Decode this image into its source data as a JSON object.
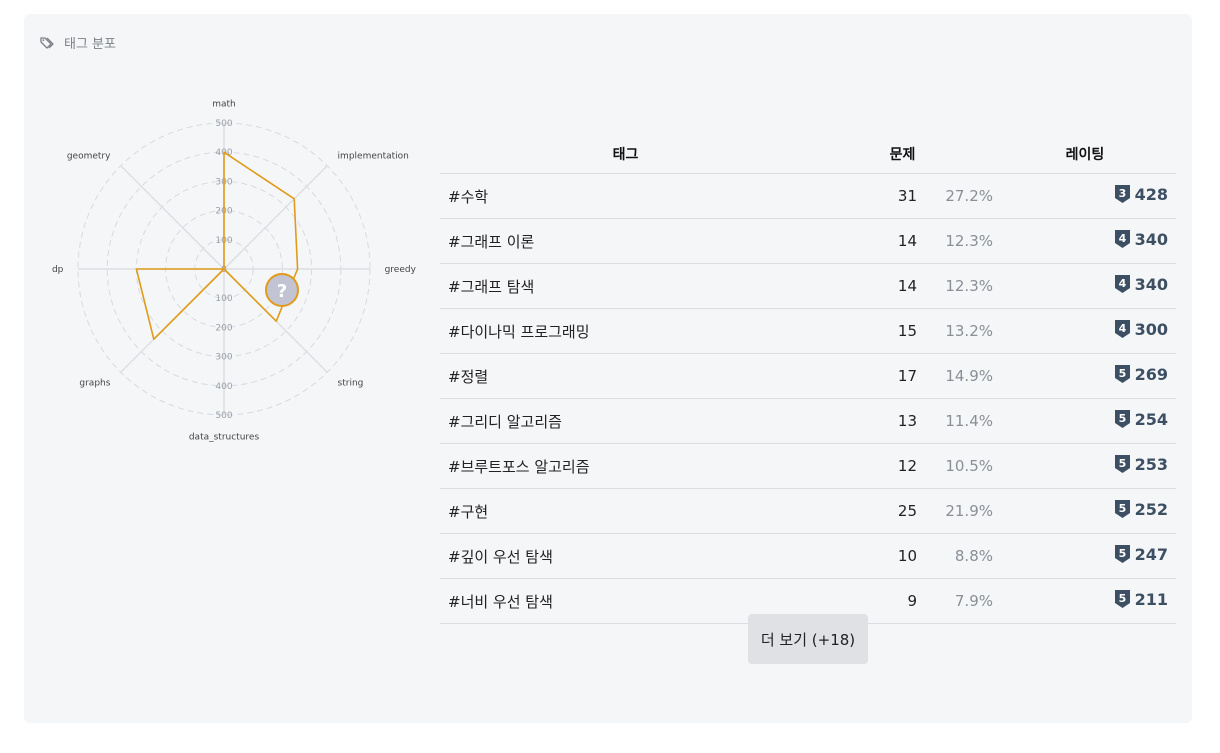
{
  "header": {
    "title": "태그 분포",
    "icon": "tags-icon"
  },
  "chart_data": {
    "type": "radar",
    "axes": [
      "math",
      "implementation",
      "greedy",
      "string",
      "data_structures",
      "graphs",
      "dp",
      "geometry"
    ],
    "values": [
      400,
      340,
      252,
      253,
      0,
      340,
      300,
      0
    ],
    "rmax": 500,
    "ticks": [
      0,
      100,
      200,
      300,
      400,
      500
    ],
    "series_color": "#e09b1a",
    "marker": {
      "label": "?",
      "fill": "#c2c4d4",
      "stroke": "#e09b1a"
    }
  },
  "table": {
    "headers": {
      "tag": "태그",
      "count": "문제",
      "rating": "레이팅"
    },
    "rows": [
      {
        "tag": "#수학",
        "count": "31",
        "ratio": "27.2%",
        "tier": "3",
        "rating": "428"
      },
      {
        "tag": "#그래프 이론",
        "count": "14",
        "ratio": "12.3%",
        "tier": "4",
        "rating": "340"
      },
      {
        "tag": "#그래프 탐색",
        "count": "14",
        "ratio": "12.3%",
        "tier": "4",
        "rating": "340"
      },
      {
        "tag": "#다이나믹 프로그래밍",
        "count": "15",
        "ratio": "13.2%",
        "tier": "4",
        "rating": "300"
      },
      {
        "tag": "#정렬",
        "count": "17",
        "ratio": "14.9%",
        "tier": "5",
        "rating": "269"
      },
      {
        "tag": "#그리디 알고리즘",
        "count": "13",
        "ratio": "11.4%",
        "tier": "5",
        "rating": "254"
      },
      {
        "tag": "#브루트포스 알고리즘",
        "count": "12",
        "ratio": "10.5%",
        "tier": "5",
        "rating": "253"
      },
      {
        "tag": "#구현",
        "count": "25",
        "ratio": "21.9%",
        "tier": "5",
        "rating": "252"
      },
      {
        "tag": "#깊이 우선 탐색",
        "count": "10",
        "ratio": "8.8%",
        "tier": "5",
        "rating": "247"
      },
      {
        "tag": "#너비 우선 탐색",
        "count": "9",
        "ratio": "7.9%",
        "tier": "5",
        "rating": "211"
      }
    ]
  },
  "more_button": {
    "label": "더 보기 (+18)"
  },
  "colors": {
    "badge": "#3d4f63",
    "accent": "#e09b1a"
  }
}
